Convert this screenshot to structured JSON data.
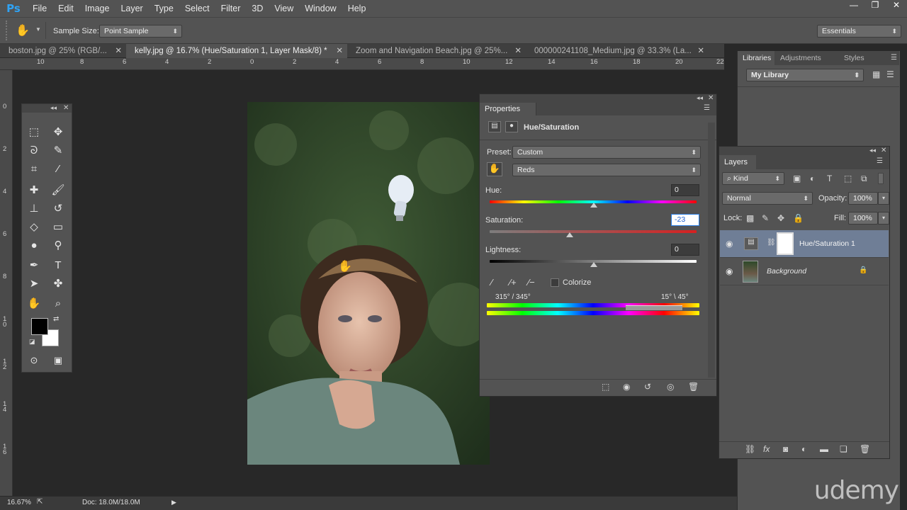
{
  "app": {
    "logo": "Ps"
  },
  "menu": [
    "File",
    "Edit",
    "Image",
    "Layer",
    "Type",
    "Select",
    "Filter",
    "3D",
    "View",
    "Window",
    "Help"
  ],
  "window_controls": {
    "minimize": "—",
    "restore": "❐",
    "close": "✕"
  },
  "options_bar": {
    "tool_icon": "hand-icon",
    "sample_size_label": "Sample Size:",
    "sample_size_value": "Point Sample",
    "workspace": "Essentials"
  },
  "doc_tabs": [
    {
      "label": "boston.jpg @ 25% (RGB/...",
      "active": false
    },
    {
      "label": "kelly.jpg @ 16.7% (Hue/Saturation 1, Layer Mask/8) *",
      "active": true
    },
    {
      "label": "Zoom and Navigation Beach.jpg @ 25%...",
      "active": false
    },
    {
      "label": "000000241108_Medium.jpg @ 33.3% (La...",
      "active": false
    }
  ],
  "ruler_h": [
    "10",
    "8",
    "6",
    "4",
    "2",
    "0",
    "2",
    "4",
    "6",
    "8",
    "10",
    "12",
    "14",
    "16",
    "18",
    "20",
    "22"
  ],
  "ruler_v": [
    "0",
    "2",
    "4",
    "6",
    "8",
    "10",
    "12",
    "14",
    "16"
  ],
  "properties": {
    "title": "Properties",
    "adjustment": "Hue/Saturation",
    "preset_label": "Preset:",
    "preset_value": "Custom",
    "channel_value": "Reds",
    "hue_label": "Hue:",
    "hue_value": "0",
    "saturation_label": "Saturation:",
    "saturation_value": "-23",
    "lightness_label": "Lightness:",
    "lightness_value": "0",
    "colorize_label": "Colorize",
    "range_left": "315° / 345°",
    "range_right": "15° \\ 45°"
  },
  "libraries": {
    "tabs": [
      "Libraries",
      "Adjustments",
      "Styles"
    ],
    "library_value": "My Library"
  },
  "layers": {
    "title": "Layers",
    "filter_value": "Kind",
    "blend_mode": "Normal",
    "opacity_label": "Opacity:",
    "opacity_value": "100%",
    "lock_label": "Lock:",
    "fill_label": "Fill:",
    "fill_value": "100%",
    "items": [
      {
        "name": "Hue/Saturation 1",
        "selected": true
      },
      {
        "name": "Background",
        "selected": false
      }
    ]
  },
  "status": {
    "zoom": "16.67%",
    "doc": "Doc: 18.0M/18.0M"
  },
  "watermark": "udemy"
}
